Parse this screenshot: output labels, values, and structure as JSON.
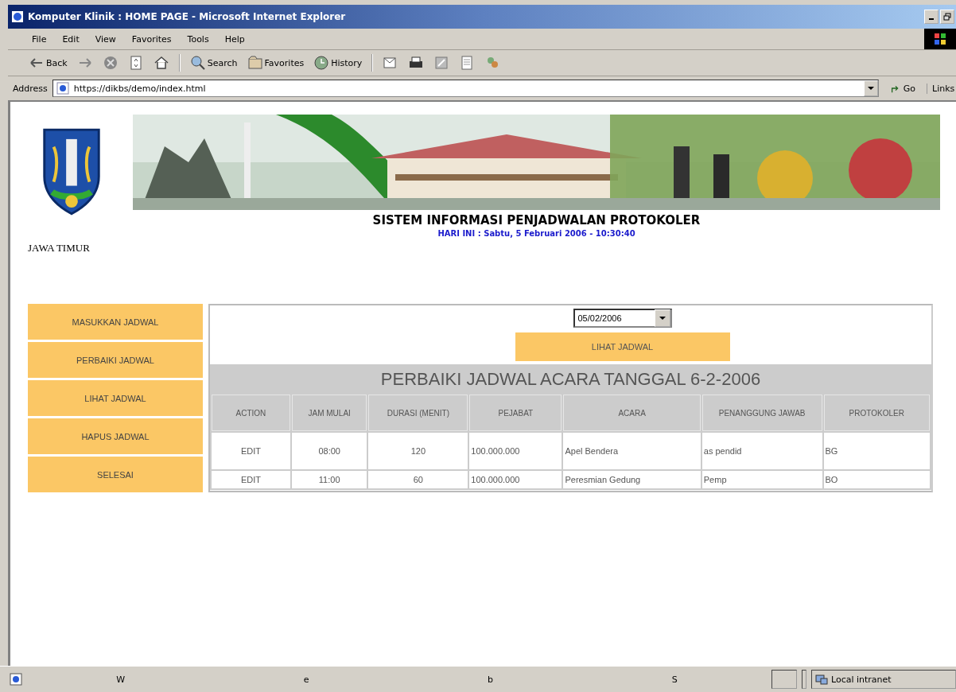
{
  "window": {
    "title": "Komputer Klinik : HOME PAGE - Microsoft Internet Explorer"
  },
  "menu": [
    "File",
    "Edit",
    "View",
    "Favorites",
    "Tools",
    "Help"
  ],
  "toolbar": [
    {
      "kind": "back",
      "label": "Back"
    },
    {
      "kind": "forward"
    },
    {
      "kind": "stop"
    },
    {
      "kind": "refresh"
    },
    {
      "kind": "home"
    },
    {
      "kind": "search",
      "label": "Search"
    },
    {
      "kind": "favorites",
      "label": "Favorites"
    },
    {
      "kind": "history",
      "label": "History"
    },
    {
      "kind": "mail"
    },
    {
      "kind": "print"
    },
    {
      "kind": "edit"
    },
    {
      "kind": "discuss"
    },
    {
      "kind": "messenger"
    }
  ],
  "address": {
    "label": "Address",
    "value": "https://dikbs/demo/index.html",
    "go": "Go",
    "links": "Links"
  },
  "page": {
    "logo_caption": "JAWA TIMUR",
    "title": "SISTEM INFORMASI PENJADWALAN PROTOKOLER",
    "date_line": "HARI INI :  Sabtu, 5 Februari 2006 - 10:30:40",
    "nav": [
      "MASUKKAN JADWAL",
      "PERBAIKI JADWAL",
      "LIHAT JADWAL",
      "HAPUS JADWAL",
      "SELESAI"
    ],
    "date_select": "05/02/2006",
    "view_button": "LIHAT JADWAL",
    "heading": "PERBAIKI JADWAL ACARA TANGGAL 6-2-2006",
    "columns": [
      "ACTION",
      "JAM MULAI",
      "DURASI (MENIT)",
      "PEJABAT",
      "ACARA",
      "PENANGGUNG JAWAB",
      "PROTOKOLER"
    ],
    "rows": [
      [
        "EDIT",
        "08:00",
        "120",
        "100.000.000",
        "Apel Bendera",
        "as pendid",
        "BG"
      ],
      [
        "EDIT",
        "11:00",
        "60",
        "100.000.000",
        "Peresmian Gedung",
        "Pemp",
        "BO"
      ]
    ]
  },
  "status_bar": {
    "texts": [
      "W",
      "e",
      "b",
      "S"
    ],
    "zone": "Local intranet"
  }
}
